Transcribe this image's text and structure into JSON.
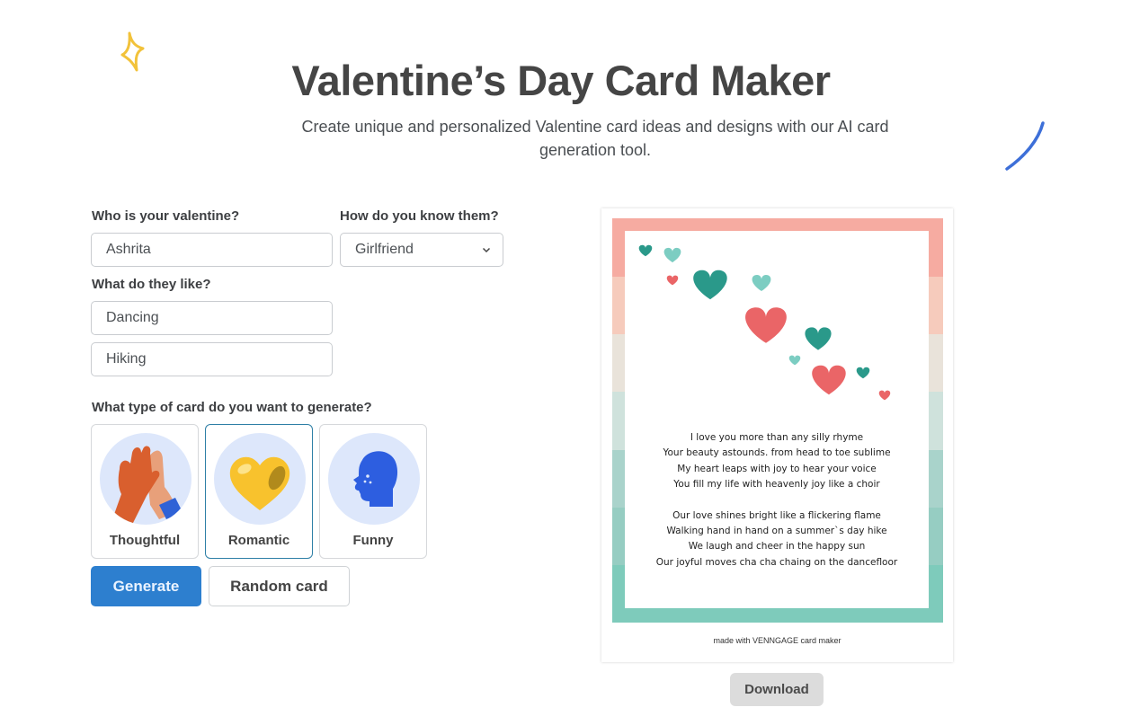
{
  "header": {
    "title": "Valentine’s Day Card Maker",
    "subtitle": "Create unique and personalized Valentine card ideas and designs with our AI card generation tool."
  },
  "form": {
    "valentine_label": "Who is your valentine?",
    "valentine_value": "Ashrita",
    "relation_label": "How do you know them?",
    "relation_value": "Girlfriend",
    "likes_label": "What do they like?",
    "likes": [
      "Dancing",
      "Hiking"
    ],
    "type_label": "What type of card do you want to generate?",
    "card_types": [
      {
        "label": "Thoughtful",
        "icon": "high-five-icon",
        "selected": false
      },
      {
        "label": "Romantic",
        "icon": "heart-icon",
        "selected": true
      },
      {
        "label": "Funny",
        "icon": "laughing-face-icon",
        "selected": false
      }
    ],
    "generate_label": "Generate",
    "random_label": "Random card"
  },
  "preview": {
    "stripe_colors": [
      "#f6aba1",
      "#f6cbbc",
      "#e9e3da",
      "#cfe2dc",
      "#a9d3cb",
      "#96cdc2",
      "#7ecbbb"
    ],
    "heart_colors": {
      "teal_dark": "#2a998a",
      "teal_light": "#7ccdc2",
      "coral": "#ea6567"
    },
    "poem_stanza_1": [
      "I love you more than any silly rhyme",
      "Your beauty astounds. from head to toe sublime",
      "My heart leaps with joy to hear your voice",
      "You fill my life with heavenly joy like a choir"
    ],
    "poem_stanza_2": [
      "Our love shines bright like a flickering flame",
      "Walking hand in hand on a summer`s day hike",
      "We laugh and cheer in the happy sun",
      "Our joyful moves cha cha chaing on the dancefloor"
    ],
    "footnote": "made with VENNGAGE card maker",
    "download_label": "Download"
  },
  "colors": {
    "primary": "#2d7fcf",
    "selected_border": "#2e7fa6",
    "sparkle": "#f2c23a",
    "stroke": "#3d6fd8"
  }
}
